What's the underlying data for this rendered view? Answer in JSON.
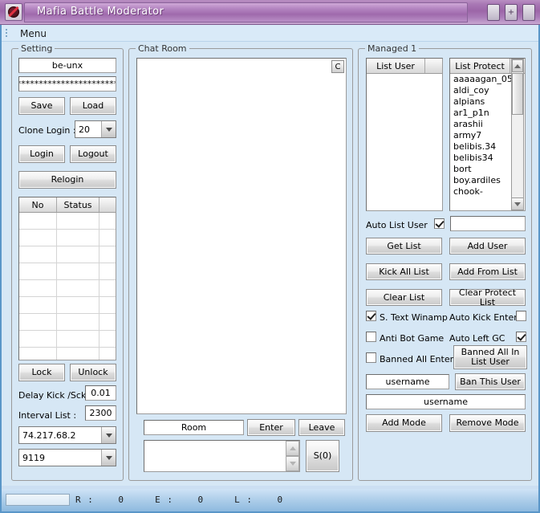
{
  "window": {
    "title": "Mafia Battle Moderator",
    "controls": [
      "minimize",
      "maximize",
      "close"
    ],
    "accent_color": "#9f6aac",
    "surface_color": "#d6e7f5"
  },
  "menubar": {
    "items": [
      "Menu"
    ]
  },
  "setting": {
    "group_label": "Setting",
    "username_value": "be-unx",
    "password_value": "*************************",
    "save_label": "Save",
    "load_label": "Load",
    "clone_login_label": "Clone Login :",
    "clone_login_value": "20",
    "login_label": "Login",
    "logout_label": "Logout",
    "relogin_label": "Relogin",
    "table_headers": [
      "No",
      "Status",
      ""
    ],
    "table_rows": [],
    "lock_label": "Lock",
    "unlock_label": "Unlock",
    "delay_kick_label": "Delay Kick /Sck :",
    "delay_kick_value": "0.01",
    "interval_list_label": "Interval List :",
    "interval_list_value": "2300",
    "host_value": "74.217.68.2",
    "port_value": "9119"
  },
  "chat": {
    "group_label": "Chat Room",
    "clear_button_label": "C",
    "log_text": "",
    "room_value": "Room",
    "enter_label": "Enter",
    "leave_label": "Leave",
    "message_value": "",
    "send_label": "S(0)"
  },
  "managed": {
    "group_label": "Managed 1",
    "list_user_header": "List User",
    "list_user_items": [],
    "list_protect_header": "List Protect",
    "list_protect_items": [
      "aaaaagan_05",
      "aldi_coy",
      "alpians",
      "ar1_p1n",
      "arashii",
      "army7",
      "belibis.34",
      "belibis34",
      "bort",
      "boy.ardiles",
      "chook-"
    ],
    "auto_list_user_label": "Auto List User",
    "auto_list_user_checked": true,
    "auto_list_user_value": "",
    "get_list_label": "Get List",
    "add_user_label": "Add User",
    "kick_all_list_label": "Kick All List",
    "add_from_list_label": "Add From List",
    "clear_list_label": "Clear List",
    "clear_protect_list_label": "Clear Protect List",
    "s_text_winamp_label": "S. Text Winamp",
    "s_text_winamp_checked": true,
    "auto_kick_enter_label": "Auto Kick Enter",
    "auto_kick_enter_checked": false,
    "anti_bot_game_label": "Anti Bot Game",
    "anti_bot_game_checked": false,
    "auto_left_gc_label": "Auto Left GC",
    "auto_left_gc_checked": true,
    "banned_all_enter_label": "Banned All Enter",
    "banned_all_enter_checked": false,
    "banned_all_in_list_user_label": "Banned All In List User",
    "ban_username_value": "username",
    "ban_this_user_label": "Ban This User",
    "mode_username_value": "username",
    "add_mode_label": "Add Mode",
    "remove_mode_label": "Remove Mode"
  },
  "statusbar": {
    "progress_percent": 0,
    "counters_text": "R :    0     E :    0     L :    0"
  }
}
